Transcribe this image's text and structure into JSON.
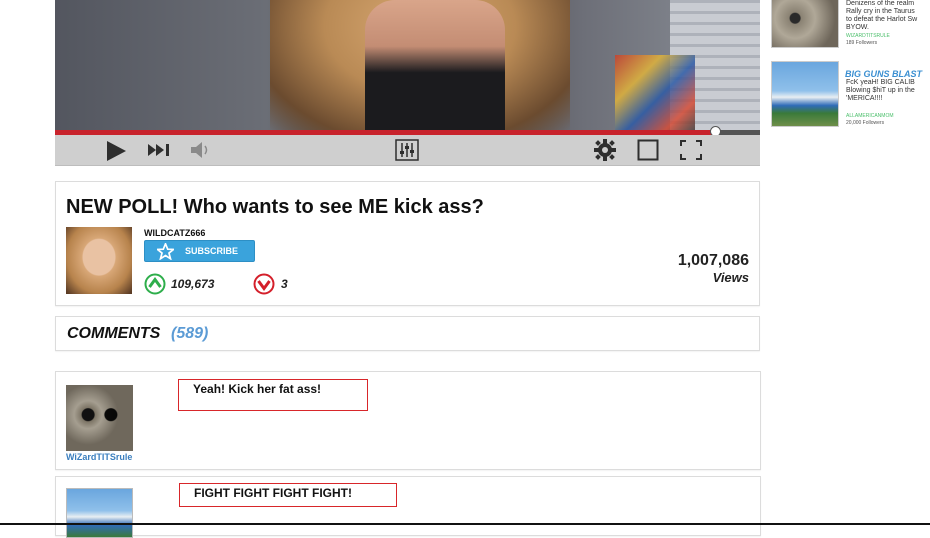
{
  "player": {
    "icons": [
      "play-icon",
      "next-icon",
      "volume-icon",
      "equalizer-icon",
      "settings-gear-icon",
      "theater-mode-icon",
      "fullscreen-icon"
    ],
    "progress_fraction": 0.936,
    "colors": {
      "progress": "#c8232c",
      "controls_bg": "#cfcfcf"
    }
  },
  "sidebar": {
    "items": [
      {
        "description_lines": [
          "Denizens of the realm",
          "Rally cry in the Taurus",
          "to defeat the Harlot Sw",
          "BYOW."
        ],
        "channel": "WIZARDTITSRULE",
        "followers": "189 Followers"
      },
      {
        "title": "BIG GUNS BLAST",
        "description_lines": [
          "FcK yeaH! BIG CALIB",
          "Blowing $hiT up in the",
          "'MERICA!!!!"
        ],
        "channel": "ALLAMERICANMOM",
        "followers": "20,000 Followers"
      }
    ]
  },
  "video_info": {
    "title": "NEW POLL!  Who wants to see ME kick ass?",
    "username": "WILDCATZ666",
    "subscribe_label": "SUBSCRIBE",
    "upvotes": "109,673",
    "downvotes": "3",
    "views_count": "1,007,086",
    "views_label": "Views",
    "colors": {
      "subscribe": "#3aa3dc",
      "upvote": "#2eae4b",
      "downvote": "#d41f2a"
    }
  },
  "comments": {
    "label": "COMMENTS",
    "count": "(589)",
    "items": [
      {
        "username": "WiZardTITSrule",
        "text": "Yeah! Kick her fat ass!"
      },
      {
        "username": "",
        "text": "FIGHT FIGHT FIGHT FIGHT!"
      }
    ]
  }
}
